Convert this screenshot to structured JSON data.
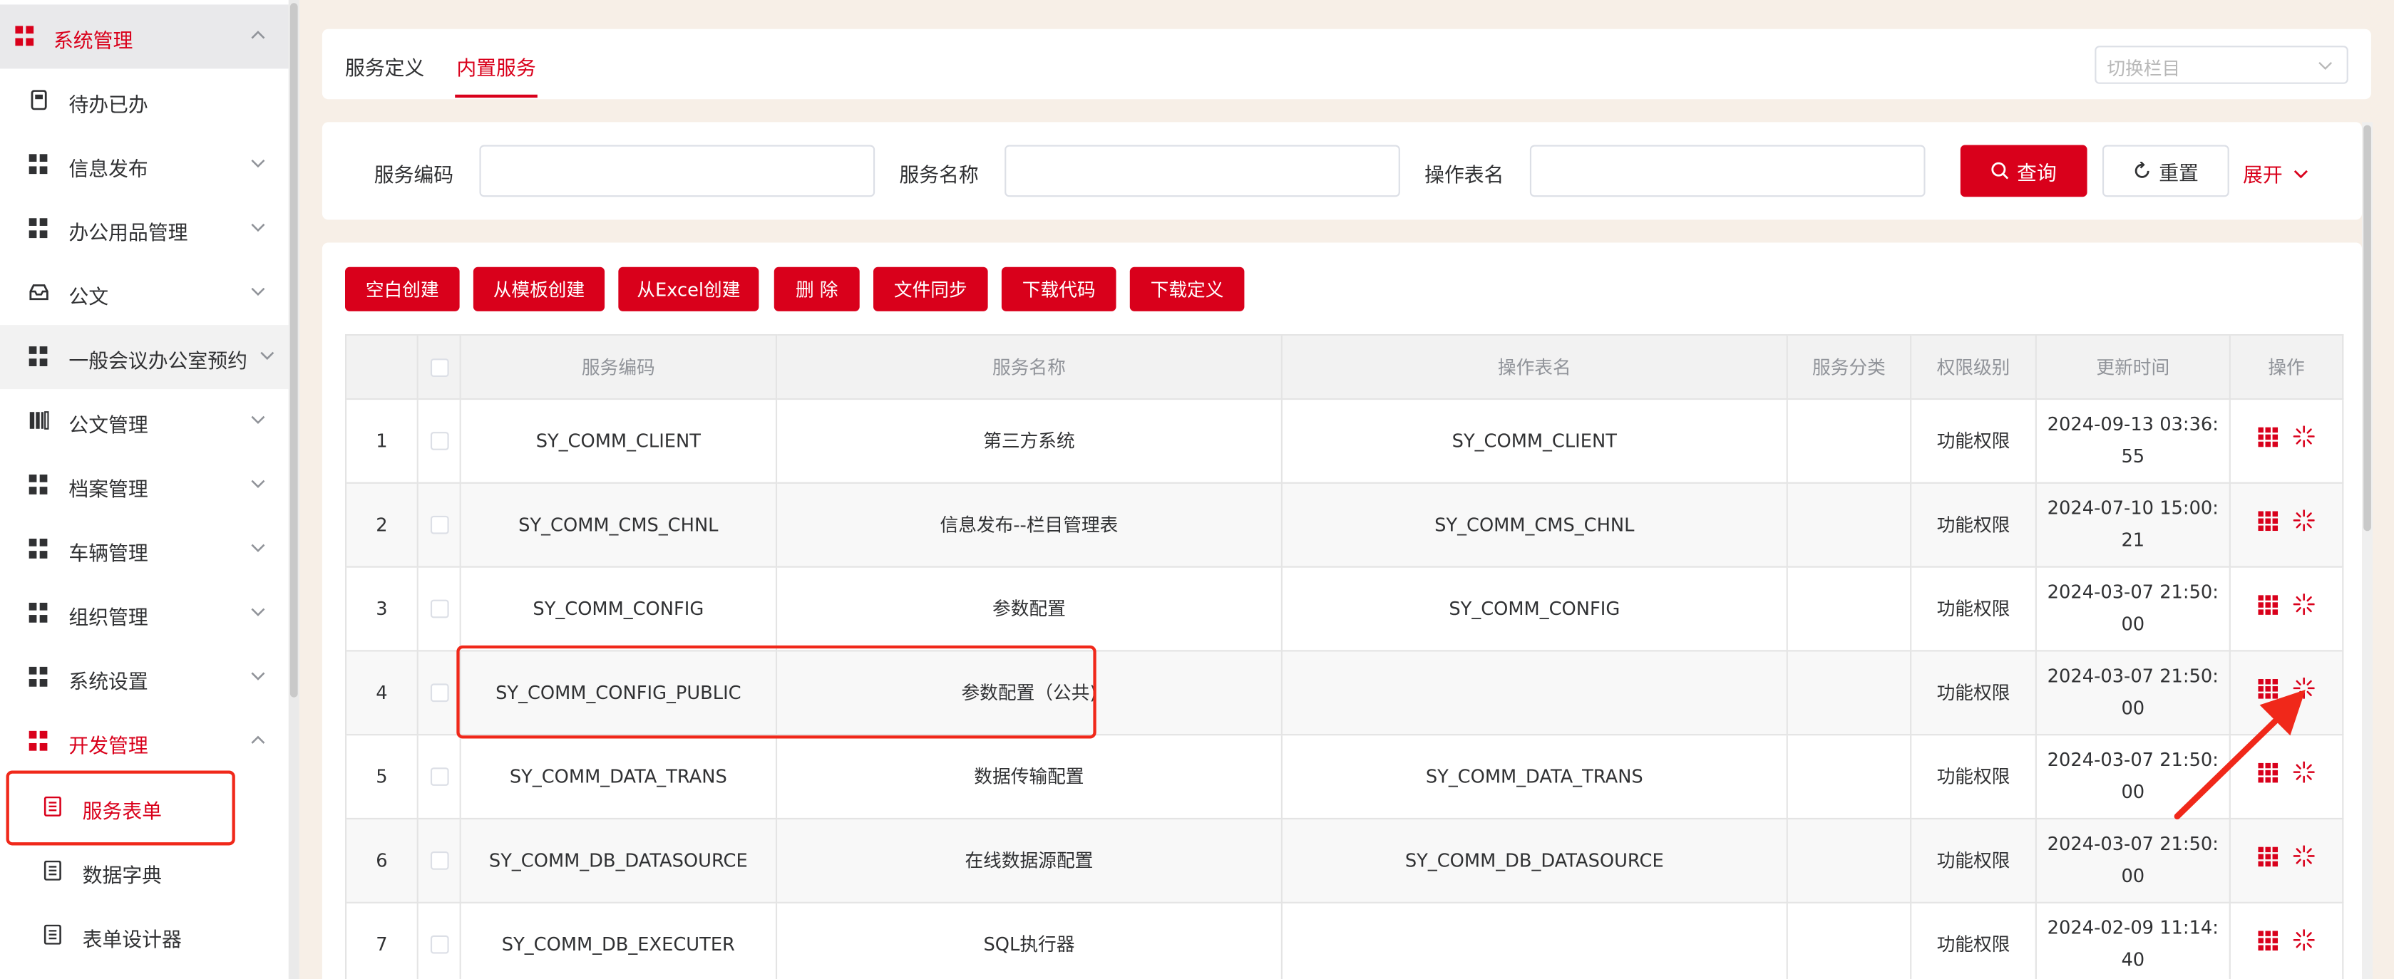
{
  "sidebar": {
    "items": [
      {
        "label": "系统管理",
        "icon": "grid-icon",
        "expanded": true
      },
      {
        "label": "待办已办",
        "icon": "document-icon"
      },
      {
        "label": "信息发布",
        "icon": "grid-icon"
      },
      {
        "label": "办公用品管理",
        "icon": "grid-icon"
      },
      {
        "label": "公文",
        "icon": "inbox-icon"
      },
      {
        "label": "一般会议办公室预约",
        "icon": "grid-icon"
      },
      {
        "label": "公文管理",
        "icon": "bar-chart-icon"
      },
      {
        "label": "档案管理",
        "icon": "grid-icon"
      },
      {
        "label": "车辆管理",
        "icon": "grid-icon"
      },
      {
        "label": "组织管理",
        "icon": "grid-icon"
      },
      {
        "label": "系统设置",
        "icon": "grid-icon"
      },
      {
        "label": "开发管理",
        "icon": "grid-icon",
        "expanded": true
      },
      {
        "label": "服务表单",
        "icon": "form-icon",
        "selected": true
      },
      {
        "label": "数据字典",
        "icon": "form-icon"
      },
      {
        "label": "表单设计器",
        "icon": "form-icon"
      }
    ]
  },
  "tabs": [
    {
      "label": "服务定义"
    },
    {
      "label": "内置服务",
      "active": true
    }
  ],
  "column_switch": {
    "placeholder": "切换栏目"
  },
  "filters": {
    "code_label": "服务编码",
    "name_label": "服务名称",
    "table_label": "操作表名",
    "search_label": "查询",
    "reset_label": "重置",
    "expand_label": "展开"
  },
  "toolbar": [
    "空白创建",
    "从模板创建",
    "从Excel创建",
    "删 除",
    "文件同步",
    "下载代码",
    "下载定义"
  ],
  "table": {
    "headers": [
      "",
      "",
      "服务编码",
      "服务名称",
      "操作表名",
      "服务分类",
      "权限级别",
      "更新时间",
      "操作"
    ],
    "rows": [
      {
        "no": "1",
        "code": "SY_COMM_CLIENT",
        "name": "第三方系统",
        "table": "SY_COMM_CLIENT",
        "category": "",
        "level": "功能权限",
        "time": "2024-09-13 03:36:55"
      },
      {
        "no": "2",
        "code": "SY_COMM_CMS_CHNL",
        "name": "信息发布--栏目管理表",
        "table": "SY_COMM_CMS_CHNL",
        "category": "",
        "level": "功能权限",
        "time": "2024-07-10 15:00:21"
      },
      {
        "no": "3",
        "code": "SY_COMM_CONFIG",
        "name": "参数配置",
        "table": "SY_COMM_CONFIG",
        "category": "",
        "level": "功能权限",
        "time": "2024-03-07 21:50:00"
      },
      {
        "no": "4",
        "code": "SY_COMM_CONFIG_PUBLIC",
        "name": "参数配置（公共)",
        "table": "",
        "category": "",
        "level": "功能权限",
        "time": "2024-03-07 21:50:00"
      },
      {
        "no": "5",
        "code": "SY_COMM_DATA_TRANS",
        "name": "数据传输配置",
        "table": "SY_COMM_DATA_TRANS",
        "category": "",
        "level": "功能权限",
        "time": "2024-03-07 21:50:00"
      },
      {
        "no": "6",
        "code": "SY_COMM_DB_DATASOURCE",
        "name": "在线数据源配置",
        "table": "SY_COMM_DB_DATASOURCE",
        "category": "",
        "level": "功能权限",
        "time": "2024-03-07 21:50:00"
      },
      {
        "no": "7",
        "code": "SY_COMM_DB_EXECUTER",
        "name": "SQL执行器",
        "table": "",
        "category": "",
        "level": "功能权限",
        "time": "2024-02-09 11:14:40"
      }
    ]
  },
  "colors": {
    "accent": "#d9001b",
    "annotation": "#f0281a"
  }
}
